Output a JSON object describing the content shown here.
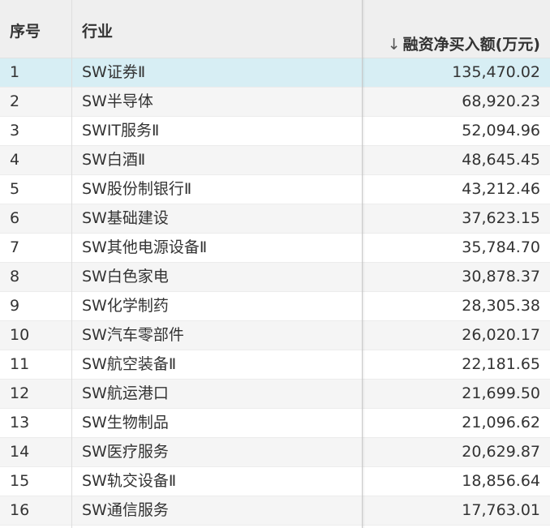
{
  "header": {
    "seq": "序号",
    "industry": "行业",
    "sort_arrow": "↓",
    "value": "融资净买入额(万元)"
  },
  "rows": [
    {
      "seq": "1",
      "industry": "SW证券Ⅱ",
      "value": "135,470.02"
    },
    {
      "seq": "2",
      "industry": "SW半导体",
      "value": "68,920.23"
    },
    {
      "seq": "3",
      "industry": "SWIT服务Ⅱ",
      "value": "52,094.96"
    },
    {
      "seq": "4",
      "industry": "SW白酒Ⅱ",
      "value": "48,645.45"
    },
    {
      "seq": "5",
      "industry": "SW股份制银行Ⅱ",
      "value": "43,212.46"
    },
    {
      "seq": "6",
      "industry": "SW基础建设",
      "value": "37,623.15"
    },
    {
      "seq": "7",
      "industry": "SW其他电源设备Ⅱ",
      "value": "35,784.70"
    },
    {
      "seq": "8",
      "industry": "SW白色家电",
      "value": "30,878.37"
    },
    {
      "seq": "9",
      "industry": "SW化学制药",
      "value": "28,305.38"
    },
    {
      "seq": "10",
      "industry": "SW汽车零部件",
      "value": "26,020.17"
    },
    {
      "seq": "11",
      "industry": "SW航空装备Ⅱ",
      "value": "22,181.65"
    },
    {
      "seq": "12",
      "industry": "SW航运港口",
      "value": "21,699.50"
    },
    {
      "seq": "13",
      "industry": "SW生物制品",
      "value": "21,096.62"
    },
    {
      "seq": "14",
      "industry": "SW医疗服务",
      "value": "20,629.87"
    },
    {
      "seq": "15",
      "industry": "SW轨交设备Ⅱ",
      "value": "18,856.64"
    },
    {
      "seq": "16",
      "industry": "SW通信服务",
      "value": "17,763.01"
    }
  ],
  "selected_row": "1",
  "colors": {
    "header_bg": "#efefef",
    "selected_bg": "#d7eef4",
    "stripe_bg": "#f5f5f5"
  }
}
